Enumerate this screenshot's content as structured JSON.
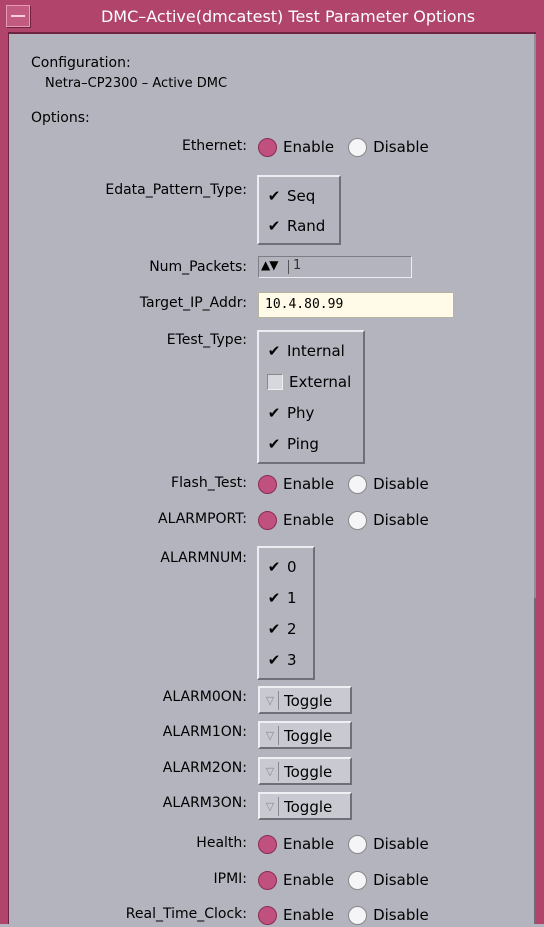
{
  "window": {
    "title": "DMC–Active(dmcatest) Test Parameter Options"
  },
  "configuration": {
    "label": "Configuration:",
    "value": "Netra–CP2300 – Active DMC"
  },
  "options_label": "Options:",
  "fields": {
    "ethernet": {
      "label": "Ethernet:",
      "enable": "Enable",
      "disable": "Disable",
      "selected": "Enable"
    },
    "edata": {
      "label": "Edata_Pattern_Type:",
      "items": [
        {
          "label": "Seq",
          "checked": true
        },
        {
          "label": "Rand",
          "checked": true
        }
      ]
    },
    "num_packets": {
      "label": "Num_Packets:",
      "value": "1"
    },
    "target_ip": {
      "label": "Target_IP_Addr:",
      "value": "10.4.80.99"
    },
    "etest": {
      "label": "ETest_Type:",
      "items": [
        {
          "label": "Internal",
          "checked": true
        },
        {
          "label": "External",
          "checked": false
        },
        {
          "label": "Phy",
          "checked": true
        },
        {
          "label": "Ping",
          "checked": true
        }
      ]
    },
    "flash_test": {
      "label": "Flash_Test:",
      "enable": "Enable",
      "disable": "Disable",
      "selected": "Enable"
    },
    "alarmport": {
      "label": "ALARMPORT:",
      "enable": "Enable",
      "disable": "Disable",
      "selected": "Enable"
    },
    "alarmnum": {
      "label": "ALARMNUM:",
      "items": [
        {
          "label": "0",
          "checked": true
        },
        {
          "label": "1",
          "checked": true
        },
        {
          "label": "2",
          "checked": true
        },
        {
          "label": "3",
          "checked": true
        }
      ]
    },
    "alarm0on": {
      "label": "ALARM0ON:",
      "button": "Toggle"
    },
    "alarm1on": {
      "label": "ALARM1ON:",
      "button": "Toggle"
    },
    "alarm2on": {
      "label": "ALARM2ON:",
      "button": "Toggle"
    },
    "alarm3on": {
      "label": "ALARM3ON:",
      "button": "Toggle"
    },
    "health": {
      "label": "Health:",
      "enable": "Enable",
      "disable": "Disable",
      "selected": "Enable"
    },
    "ipmi": {
      "label": "IPMI:",
      "enable": "Enable",
      "disable": "Disable",
      "selected": "Enable"
    },
    "rtc": {
      "label": "Real_Time_Clock:",
      "enable": "Enable",
      "disable": "Disable",
      "selected": "Enable"
    }
  },
  "colors": {
    "accent": "#b0446a",
    "radio_on": "#c0507e",
    "background": "#b4b4bf",
    "input_bg": "#fffbe8"
  }
}
